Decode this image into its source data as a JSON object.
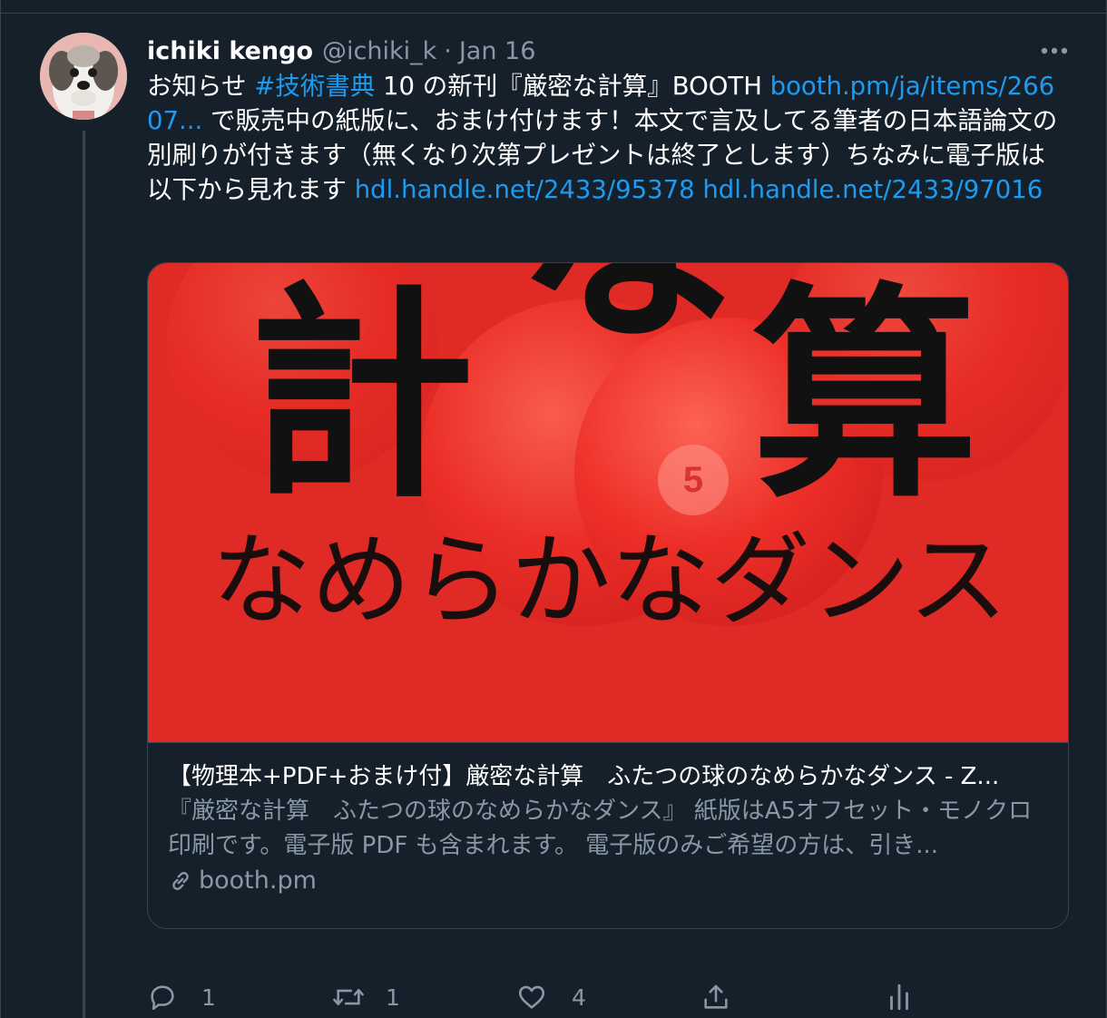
{
  "tweet": {
    "display_name": "ichiki kengo",
    "handle": "@ichiki_k",
    "separator": "·",
    "time": "Jan 16",
    "text": {
      "p1": "お知らせ ",
      "hashtag": "#技術書典",
      "p2": " 10 の新刊『厳密な計算』BOOTH ",
      "link1": "booth.pm/ja/items/26607...",
      "p3": " で販売中の紙版に、おまけ付けます！本文で言及してる筆者の日本語論文の別刷りが付きます（無くなり次第プレゼントは終了とします）ちなみに電子版は以下から見れます ",
      "link2": "hdl.handle.net/2433/95378",
      "p4": " ",
      "link3": "hdl.handle.net/2433/97016"
    },
    "card": {
      "image_text_large_left": "計",
      "image_text_large_center": "な",
      "image_text_large_right": "算",
      "image_text_sub": "なめらかなダンス",
      "ball_number": "5",
      "title": "【物理本+PDF+おまけ付】厳密な計算　ふたつの球のなめらかなダンス - Z...",
      "description": "『厳密な計算　ふたつの球のなめらかなダンス』 紙版はA5オフセット・モノクロ印刷です。電子版 PDF も含まれます。 電子版のみご希望の方は、引き...",
      "domain": "booth.pm"
    },
    "actions": {
      "reply_count": "1",
      "retweet_count": "1",
      "like_count": "4"
    }
  },
  "colors": {
    "background": "#15202b",
    "border": "#38444d",
    "link": "#1d9bf0",
    "secondary_text": "#8899a6",
    "card_image_red": "#e02a25"
  },
  "icons": [
    "more-icon",
    "reply-icon",
    "retweet-icon",
    "like-icon",
    "share-icon",
    "analytics-icon",
    "link-icon"
  ]
}
